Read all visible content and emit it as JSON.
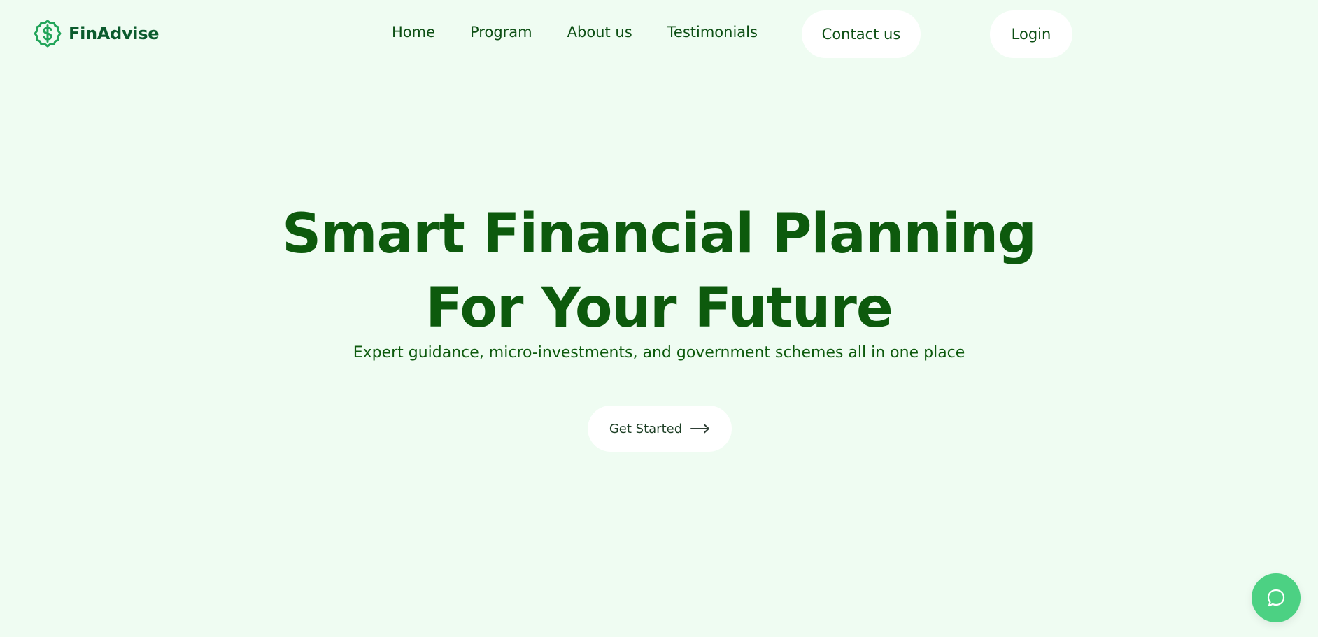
{
  "brand": {
    "name": "FinAdvise",
    "icon": "dollar-badge-icon",
    "color": "#0b5b2d",
    "accent": "#22a55a"
  },
  "nav": {
    "items": [
      {
        "label": "Home"
      },
      {
        "label": "Program"
      },
      {
        "label": "About us"
      },
      {
        "label": "Testimonials"
      }
    ],
    "contact_label": "Contact us",
    "login_label": "Login"
  },
  "hero": {
    "title_line1": "Smart Financial Planning",
    "title_line2": "For Your Future",
    "subtitle": "Expert guidance, micro-investments, and government schemes all in one place",
    "cta_label": "Get Started",
    "cta_icon": "arrow-right-icon"
  },
  "chat": {
    "icon": "chat-bubble-icon",
    "color": "#4cd183"
  },
  "colors": {
    "background": "#effcf2",
    "heading": "#0d5a0d",
    "button_bg": "#ffffff"
  }
}
